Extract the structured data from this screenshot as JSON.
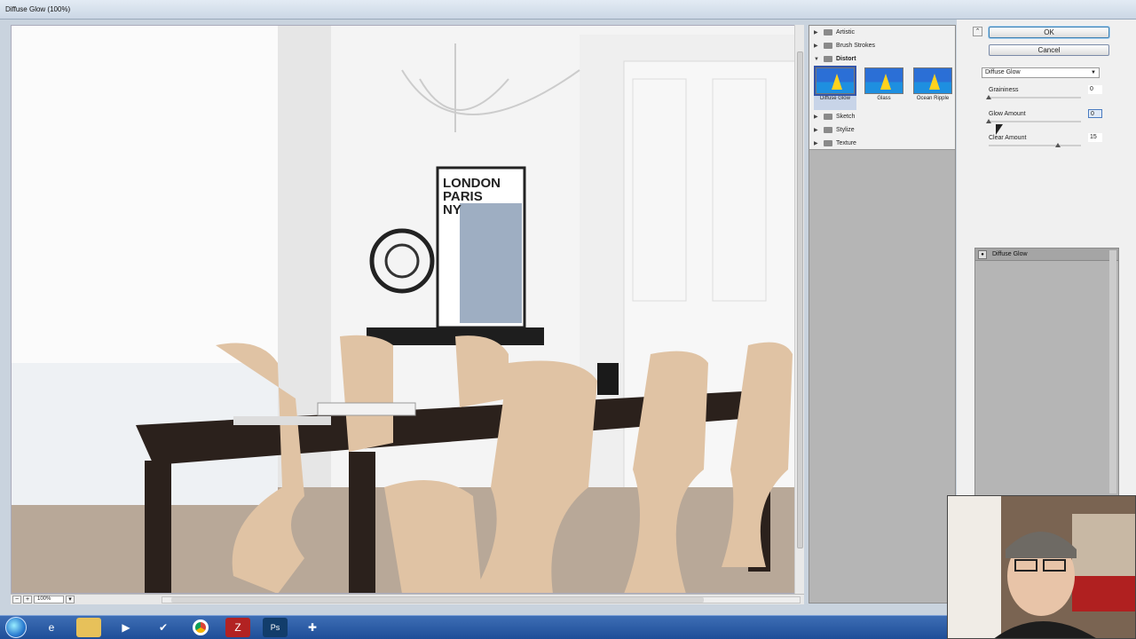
{
  "window": {
    "title": "Diffuse Glow (100%)"
  },
  "canvas": {
    "zoom": "100%",
    "poster_lines": [
      "LONDON",
      "PARIS",
      "NY"
    ]
  },
  "gallery": {
    "categories_before": [
      {
        "label": "Artistic",
        "expanded": false
      },
      {
        "label": "Brush Strokes",
        "expanded": false
      },
      {
        "label": "Distort",
        "expanded": true
      }
    ],
    "distort_thumbs": [
      {
        "label": "Diffuse Glow",
        "selected": true
      },
      {
        "label": "Glass",
        "selected": false
      },
      {
        "label": "Ocean Ripple",
        "selected": false
      }
    ],
    "categories_after": [
      {
        "label": "Sketch"
      },
      {
        "label": "Stylize"
      },
      {
        "label": "Texture"
      }
    ]
  },
  "dialog": {
    "ok_label": "OK",
    "cancel_label": "Cancel",
    "filter_select": "Diffuse Glow",
    "params": [
      {
        "label": "Graininess",
        "value": "0",
        "level": 0
      },
      {
        "label": "Glow Amount",
        "value": "0",
        "level": 0,
        "focused": true
      },
      {
        "label": "Clear Amount",
        "value": "15",
        "level": 0.75
      }
    ]
  },
  "layers": {
    "items": [
      {
        "label": "Diffuse Glow",
        "visible": true
      }
    ]
  },
  "taskbar": {
    "icons": [
      "windows-start-icon",
      "internet-explorer-icon",
      "folder-icon",
      "media-player-icon",
      "checkmark-app-icon",
      "chrome-icon",
      "filezilla-icon",
      "photoshop-icon",
      "tools-icon"
    ]
  },
  "colors": {
    "accent": "#3c7fb1",
    "panel": "#f0f0f0",
    "gallery_bg": "#b5b5b5",
    "taskbar": "#1e4e98"
  }
}
